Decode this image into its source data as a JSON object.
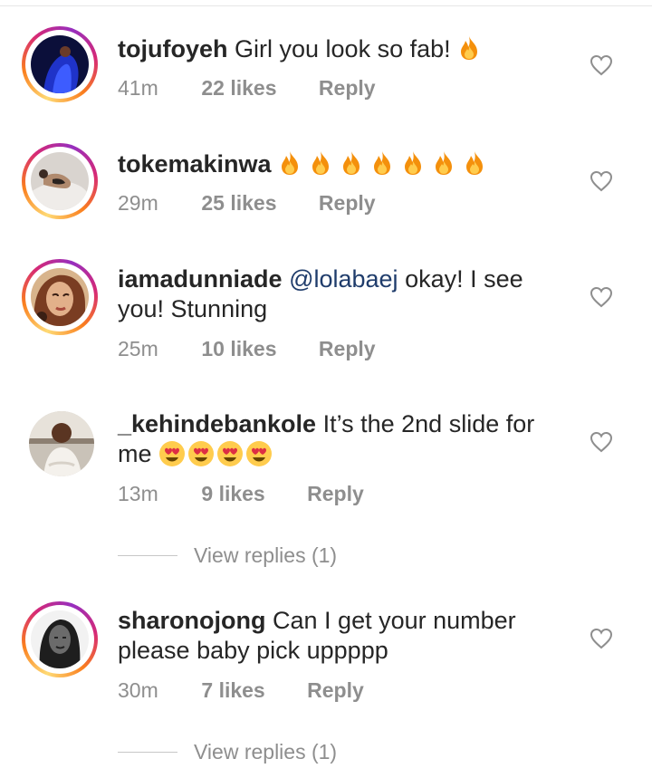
{
  "comments": [
    {
      "username": "tojufoyeh",
      "text": "Girl you look so fab!",
      "emoji": "fire-emoji",
      "time": "41m",
      "likes": "22 likes",
      "reply": "Reply"
    },
    {
      "username": "tokemakinwa",
      "text": "",
      "emoji": "fire-emoji x7",
      "time": "29m",
      "likes": "25 likes",
      "reply": "Reply"
    },
    {
      "username": "iamadunniade",
      "mention": "@lolabaej",
      "text": "okay! I see you! Stunning",
      "time": "25m",
      "likes": "10 likes",
      "reply": "Reply"
    },
    {
      "username": "_kehindebankole",
      "text": "It’s the 2nd slide for me",
      "emoji": "heart-eyes-emoji x4",
      "time": "13m",
      "likes": "9 likes",
      "reply": "Reply",
      "view_replies": "View replies (1)"
    },
    {
      "username": "sharonojong",
      "text": "Can I get your number please baby pick uppppp",
      "time": "30m",
      "likes": "7 likes",
      "reply": "Reply",
      "view_replies": "View replies (1)"
    }
  ],
  "colors": {
    "username": "#262626",
    "meta": "#8e8e8e",
    "mention": "#1f3c6b",
    "story_ring": [
      "#feda75",
      "#fa7e1e",
      "#d62976",
      "#962fbf"
    ]
  },
  "icons": {
    "like": "heart-outline-icon"
  }
}
